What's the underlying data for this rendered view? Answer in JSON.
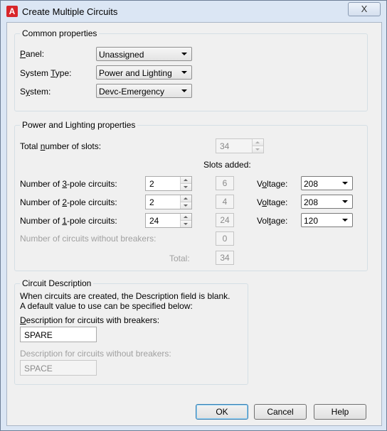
{
  "window": {
    "title": "Create Multiple Circuits",
    "close_label": "X"
  },
  "common": {
    "group_title": "Common properties",
    "panel": {
      "label_pre": "",
      "label_key": "P",
      "label_post": "anel:",
      "value": "Unassigned"
    },
    "system_type": {
      "label_pre": "System ",
      "label_key": "T",
      "label_post": "ype:",
      "value": "Power and Lighting"
    },
    "system": {
      "label_pre": "S",
      "label_key": "y",
      "label_post": "stem:",
      "value": "Devc-Emergency"
    }
  },
  "power": {
    "group_title": "Power and Lighting properties",
    "total_slots_label_pre": "Total ",
    "total_slots_label_key": "n",
    "total_slots_label_post": "umber of slots:",
    "total_slots_value": "34",
    "slots_added_header": "Slots added:",
    "rows": [
      {
        "label_pre": "Number of ",
        "label_key": "3",
        "label_post": "-pole circuits:",
        "count": "2",
        "slots": "6",
        "voltage_pre": "V",
        "voltage_key": "o",
        "voltage_post": "ltage:",
        "voltage": "208"
      },
      {
        "label_pre": "Number of ",
        "label_key": "2",
        "label_post": "-pole circuits:",
        "count": "2",
        "slots": "4",
        "voltage_pre": "V",
        "voltage_key": "o",
        "voltage_post": "ltage:",
        "voltage": "208"
      },
      {
        "label_pre": "Number of ",
        "label_key": "1",
        "label_post": "-pole circuits:",
        "count": "24",
        "slots": "24",
        "voltage_pre": "Vol",
        "voltage_key": "t",
        "voltage_post": "age:",
        "voltage": "120"
      }
    ],
    "no_breaker_label": "Number of circuits without breakers:",
    "no_breaker_slots": "0",
    "total_label": "Total:",
    "total_value": "34"
  },
  "description": {
    "group_title": "Circuit Description",
    "info_line1": "When circuits are created, the Description field is blank.",
    "info_line2": "A default value to use can be specified below:",
    "with_breakers_label_pre": "",
    "with_breakers_label_key": "D",
    "with_breakers_label_post": "escription for circuits with breakers:",
    "with_breakers_value": "SPARE",
    "without_breakers_label": "Description for circuits without breakers:",
    "without_breakers_value": "SPACE"
  },
  "buttons": {
    "ok": "OK",
    "cancel": "Cancel",
    "help": "Help"
  }
}
